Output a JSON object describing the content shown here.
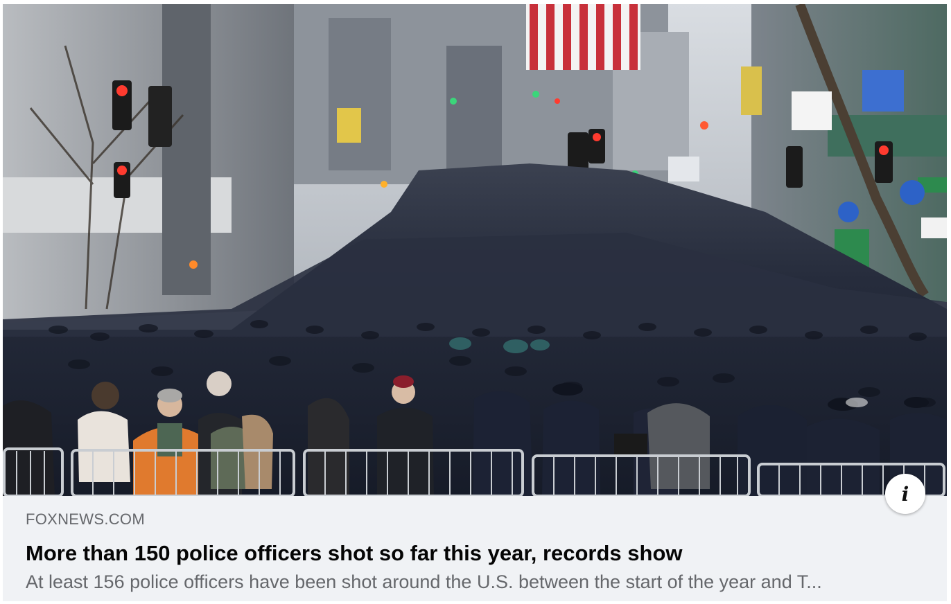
{
  "link_card": {
    "image": {
      "description_icon": "photo-police-crowd",
      "colors": {
        "sky": "#cfd3d8",
        "crowd_dark": "#1c2233",
        "crowd_mid": "#2b3246",
        "building": "#8a8f96",
        "flag_red": "#c8303a",
        "light_red": "#ff3b2f",
        "light_green": "#3bd67a",
        "jacket_orange": "#e07a2e",
        "barrier": "#c9cdd2"
      }
    },
    "info_button": {
      "icon": "info-icon",
      "glyph": "i"
    },
    "source": "FOXNEWS.COM",
    "headline": "More than 150 police officers shot so far this year, records show",
    "description": "At least 156 police officers have been shot around the U.S. between the start of the year and T..."
  }
}
